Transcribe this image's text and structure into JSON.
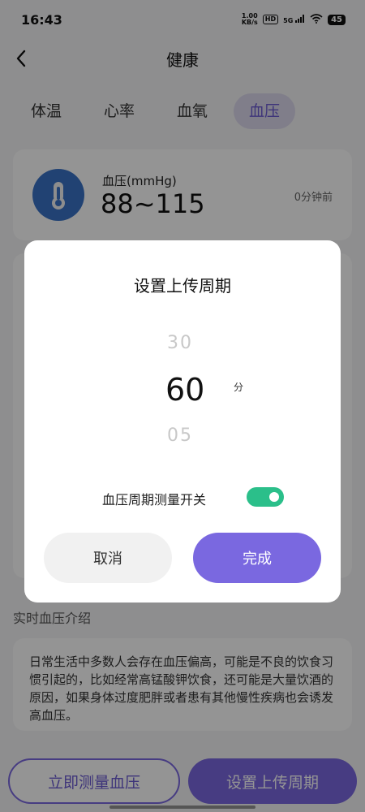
{
  "status_bar": {
    "time": "16:43",
    "net_speed_top": "1.00",
    "net_speed_bottom": "KB/s",
    "hd": "HD",
    "signal": "5G",
    "battery": "45"
  },
  "header": {
    "title": "健康"
  },
  "tabs": [
    {
      "label": "体温"
    },
    {
      "label": "心率"
    },
    {
      "label": "血氧"
    },
    {
      "label": "血压"
    }
  ],
  "bp_card": {
    "label": "血压(mmHg)",
    "value": "88~115",
    "time": "0分钟前"
  },
  "intro": {
    "title": "实时血压介绍",
    "text": "日常生活中多数人会存在血压偏高，可能是不良的饮食习惯引起的，比如经常高锰酸钾饮食，还可能是大量饮酒的原因，如果身体过度肥胖或者患有其他慢性疾病也会诱发高血压。"
  },
  "bottom": {
    "measure_label": "立即测量血压",
    "period_label": "设置上传周期"
  },
  "dialog": {
    "title": "设置上传周期",
    "picker_prev": "30",
    "picker_current": "60",
    "picker_next": "05",
    "unit": "分",
    "switch_label": "血压周期测量开关",
    "switch_on": true,
    "cancel_label": "取消",
    "done_label": "完成"
  },
  "colors": {
    "accent": "#7a68e0",
    "switch_on": "#2bbf8a",
    "icon_bg": "#3a73c7"
  }
}
